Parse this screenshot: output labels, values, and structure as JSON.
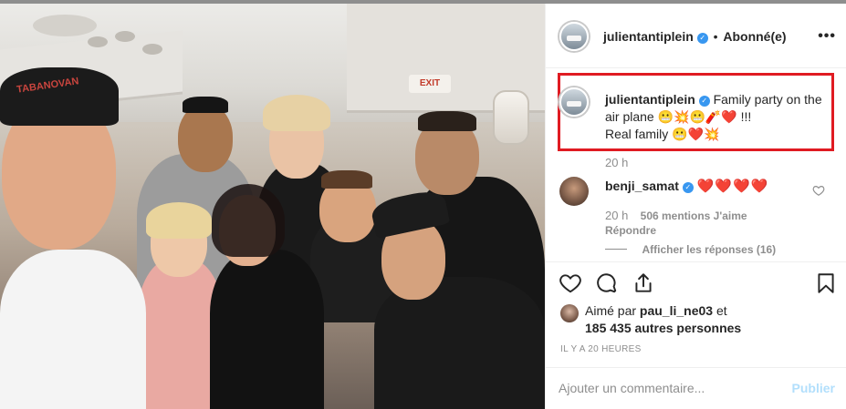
{
  "header": {
    "username": "julientantiplein",
    "separator": "•",
    "follow_status": "Abonné(e)",
    "more_icon": "more-horizontal-icon"
  },
  "photo": {
    "exit_sign": "EXIT",
    "cap_text": "TABANOVAN"
  },
  "caption": {
    "username": "julientantiplein",
    "text_line1": "Family party on the",
    "text_line2": "air plane",
    "emojis_line2": "😬💥😬🧨❤️",
    "text_line2_end": "!!!",
    "text_line3": "Real family",
    "emojis_line3": "😬❤️💥",
    "timestamp": "20 h"
  },
  "comment": {
    "username": "benji_samat",
    "text": "❤️❤️❤️❤️",
    "timestamp": "20 h",
    "likes": "506 mentions J'aime",
    "reply": "Répondre",
    "show_replies": "Afficher les réponses (16)"
  },
  "actions": {
    "like_icon": "heart-icon",
    "comment_icon": "comment-icon",
    "share_icon": "share-icon",
    "save_icon": "bookmark-icon"
  },
  "likes": {
    "prefix": "Aimé par",
    "liker": "pau_li_ne03",
    "and": "et",
    "others": "185 435 autres personnes"
  },
  "posted_ago": "IL Y A 20 HEURES",
  "add_comment": {
    "placeholder": "Ajouter un commentaire...",
    "publish": "Publier"
  },
  "colors": {
    "highlight_border": "#e01b22",
    "verified": "#3897f0",
    "publish_disabled": "#b2dffc"
  }
}
